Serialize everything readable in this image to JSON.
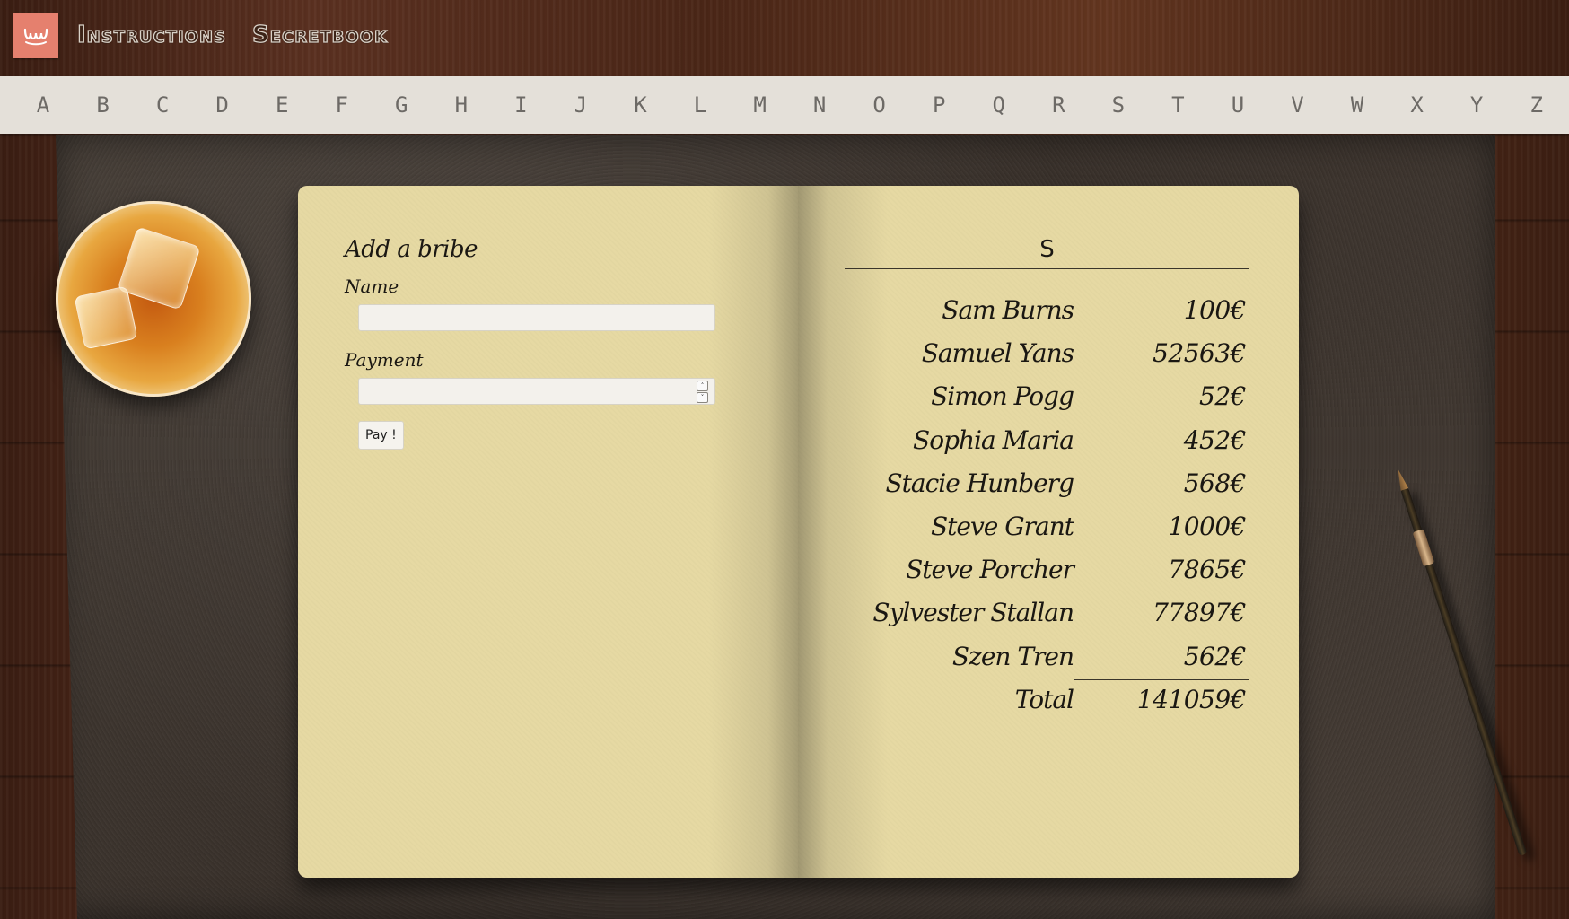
{
  "header": {
    "logo_glyph": "ɰ",
    "nav": [
      {
        "label": "Instructions"
      },
      {
        "label": "Secretbook"
      }
    ]
  },
  "alphabet": [
    "A",
    "B",
    "C",
    "D",
    "E",
    "F",
    "G",
    "H",
    "I",
    "J",
    "K",
    "L",
    "M",
    "N",
    "O",
    "P",
    "Q",
    "R",
    "S",
    "T",
    "U",
    "V",
    "W",
    "X",
    "Y",
    "Z"
  ],
  "form": {
    "title": "Add a bribe",
    "name_label": "Name",
    "name_value": "",
    "payment_label": "Payment",
    "payment_value": "",
    "stepper_up": "˄",
    "stepper_down": "˅",
    "submit_label": "Pay !"
  },
  "ledger": {
    "letter": "S",
    "entries": [
      {
        "name": "Sam Burns",
        "amount": "100€"
      },
      {
        "name": "Samuel Yans",
        "amount": "52563€"
      },
      {
        "name": "Simon Pogg",
        "amount": "52€"
      },
      {
        "name": "Sophia Maria",
        "amount": "452€"
      },
      {
        "name": "Stacie Hunberg",
        "amount": "568€"
      },
      {
        "name": "Steve Grant",
        "amount": "1000€"
      },
      {
        "name": "Steve Porcher",
        "amount": "7865€"
      },
      {
        "name": "Sylvester Stallan",
        "amount": "77897€"
      },
      {
        "name": "Szen Tren",
        "amount": "562€"
      }
    ],
    "total_label": "Total",
    "total_amount": "141059€"
  },
  "colors": {
    "logo_bg": "#e5806e",
    "page": "#e6d9a3",
    "alpha_bar": "#e4e0d9"
  },
  "icons": {
    "logo": "app-logo-icon",
    "stepper_up": "chevron-up-icon",
    "stepper_down": "chevron-down-icon"
  }
}
